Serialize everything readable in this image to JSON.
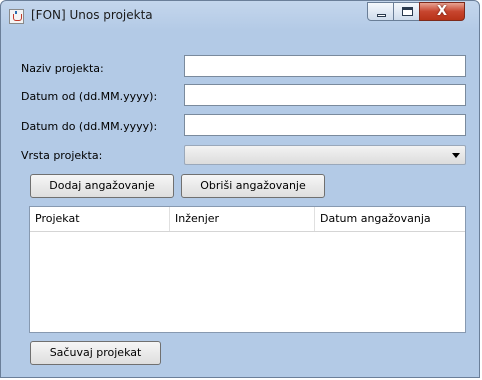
{
  "window": {
    "title": "[FON] Unos projekta",
    "controls": {
      "close_glyph": "X"
    }
  },
  "form": {
    "naziv_label": "Naziv projekta:",
    "naziv_value": "",
    "datum_od_label": "Datum od (dd.MM.yyyy):",
    "datum_od_value": "",
    "datum_do_label": "Datum do (dd.MM.yyyy):",
    "datum_do_value": "",
    "vrsta_label": "Vrsta projekta:",
    "vrsta_value": ""
  },
  "buttons": {
    "dodaj": "Dodaj angažovanje",
    "obrisi": "Obriši angažovanje",
    "sacuvaj": "Sačuvaj projekat"
  },
  "table": {
    "columns": [
      "Projekat",
      "Inženjer",
      "Datum angažovanja"
    ],
    "rows": []
  },
  "icons": {
    "app": "java-cup-icon",
    "minimize": "minimize-icon",
    "maximize": "maximize-icon",
    "close": "close-icon",
    "dropdown": "chevron-down-icon"
  }
}
